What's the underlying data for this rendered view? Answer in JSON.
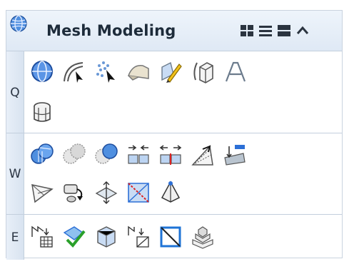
{
  "panel": {
    "title": "Mesh Modeling",
    "title_icon": "globe-icon",
    "header_buttons": [
      "grid-view-icon",
      "list-view-icon",
      "panel-view-icon",
      "collapse-icon"
    ]
  },
  "sections": [
    {
      "label": "Q",
      "tools": [
        "mesh-sphere-icon",
        "curves-pick-icon",
        "points-pick-icon",
        "surface-mesh-icon",
        "edit-pencil-icon",
        "extrude-icon",
        "text-outline-icon",
        "cylinder-mesh-icon"
      ]
    },
    {
      "label": "W",
      "tools": [
        "mesh-union-icon",
        "mesh-subtract-icon",
        "mesh-intersect-icon",
        "split-apart-icon",
        "join-together-icon",
        "fan-edges-icon",
        "project-surface-icon",
        "triangulate-icon",
        "rotate-copy-icon",
        "move-plane-icon",
        "flip-edge-icon",
        "pyramid-icon"
      ]
    },
    {
      "label": "E",
      "tools": [
        "grid-convert-icon",
        "validate-mesh-icon",
        "hexagon-mesh-icon",
        "quad-to-tri-icon",
        "diagonal-box-icon",
        "stack-mesh-icon"
      ]
    }
  ],
  "colors": {
    "accent_blue": "#3b74c4",
    "check_green": "#2aa02a",
    "tab_bg": "#dfe8f3"
  }
}
